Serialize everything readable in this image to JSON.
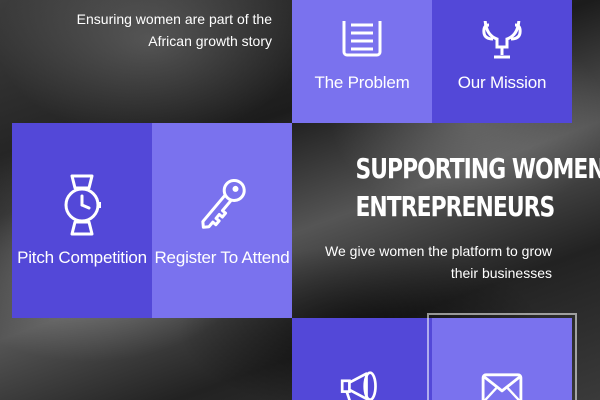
{
  "header": {
    "tagline": "Ensuring women are part of the African growth story"
  },
  "tiles": {
    "problem": {
      "label": "The Problem",
      "icon": "document-icon"
    },
    "mission": {
      "label": "Our Mission",
      "icon": "trophy-icon"
    },
    "pitch": {
      "label": "Pitch Competition",
      "icon": "wristwatch-icon"
    },
    "register": {
      "label": "Register To Attend",
      "icon": "key-icon"
    },
    "megaphone": {
      "label": "",
      "icon": "megaphone-icon"
    },
    "contact": {
      "label": "",
      "icon": "envelope-icon"
    }
  },
  "hero": {
    "title_line1": "SUPPORTING WOMEN",
    "title_line2": "ENTREPRENEURS",
    "subtitle": "We give women the platform to grow their businesses"
  },
  "colors": {
    "tile_dark": "#5348d8",
    "tile_light": "#7a72ee",
    "text": "#ffffff"
  }
}
